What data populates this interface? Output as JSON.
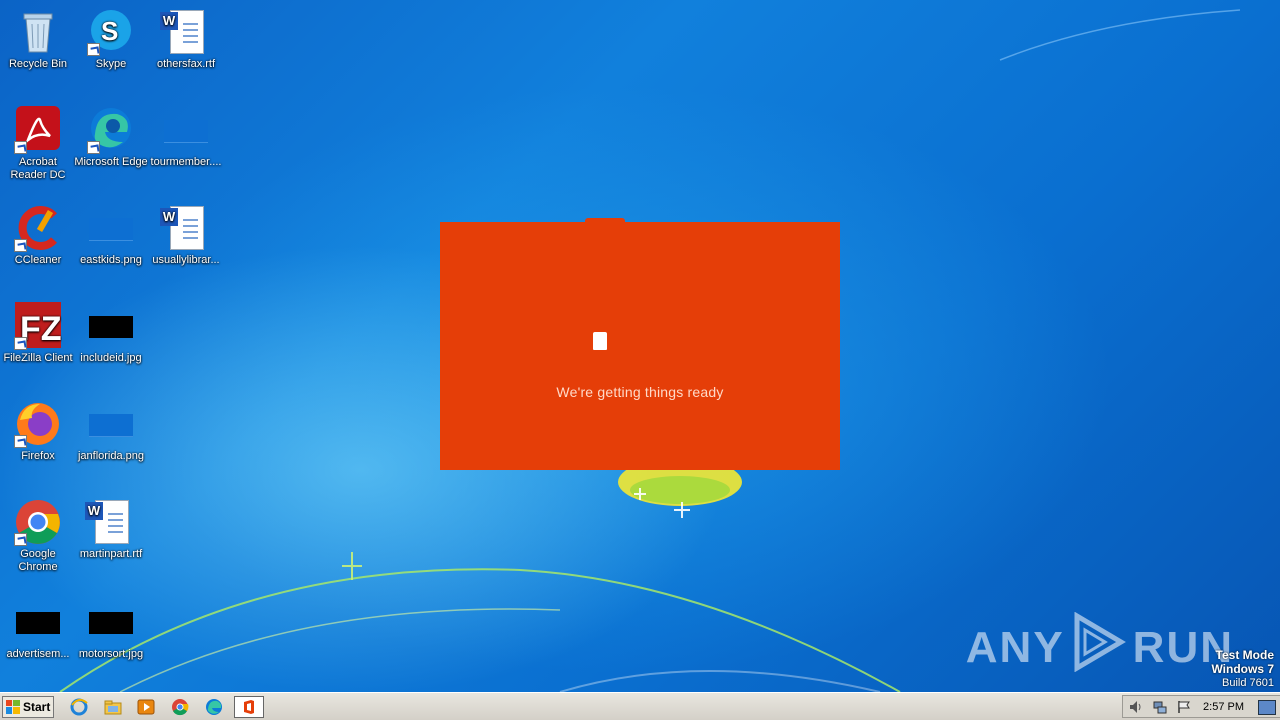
{
  "desktop": {
    "icons": [
      {
        "label": "Recycle Bin",
        "icon": "recycle-bin-icon"
      },
      {
        "label": "Skype",
        "icon": "skype-icon"
      },
      {
        "label": "othersfax.rtf",
        "icon": "word-document-icon"
      },
      {
        "label": "Acrobat Reader DC",
        "icon": "acrobat-reader-icon"
      },
      {
        "label": "Microsoft Edge",
        "icon": "edge-icon"
      },
      {
        "label": "tourmember....",
        "icon": "image-file-icon"
      },
      {
        "label": "CCleaner",
        "icon": "ccleaner-icon"
      },
      {
        "label": "eastkids.png",
        "icon": "image-file-icon"
      },
      {
        "label": "usuallylibrar...",
        "icon": "word-document-icon"
      },
      {
        "label": "FileZilla Client",
        "icon": "filezilla-icon"
      },
      {
        "label": "includeid.jpg",
        "icon": "image-file-icon"
      },
      {
        "label": "Firefox",
        "icon": "firefox-icon"
      },
      {
        "label": "janflorida.png",
        "icon": "image-file-icon"
      },
      {
        "label": "Google Chrome",
        "icon": "chrome-icon"
      },
      {
        "label": "martinpart.rtf",
        "icon": "word-document-icon"
      },
      {
        "label": "advertisem...",
        "icon": "image-file-icon"
      },
      {
        "label": "motorsort.jpg",
        "icon": "image-file-icon"
      }
    ]
  },
  "splash": {
    "message": "We're getting things ready",
    "color": "#e53e08"
  },
  "watermark": {
    "text_left": "ANY",
    "text_right": "RUN"
  },
  "os_info": {
    "line1": "Test Mode",
    "line2": "Windows 7",
    "line3": "Build 7601"
  },
  "taskbar": {
    "start_label": "Start",
    "pinned": [
      "internet-explorer-icon",
      "explorer-folder-icon",
      "media-player-icon",
      "chrome-icon",
      "edge-icon",
      "office-icon"
    ],
    "clock": "2:57 PM"
  }
}
